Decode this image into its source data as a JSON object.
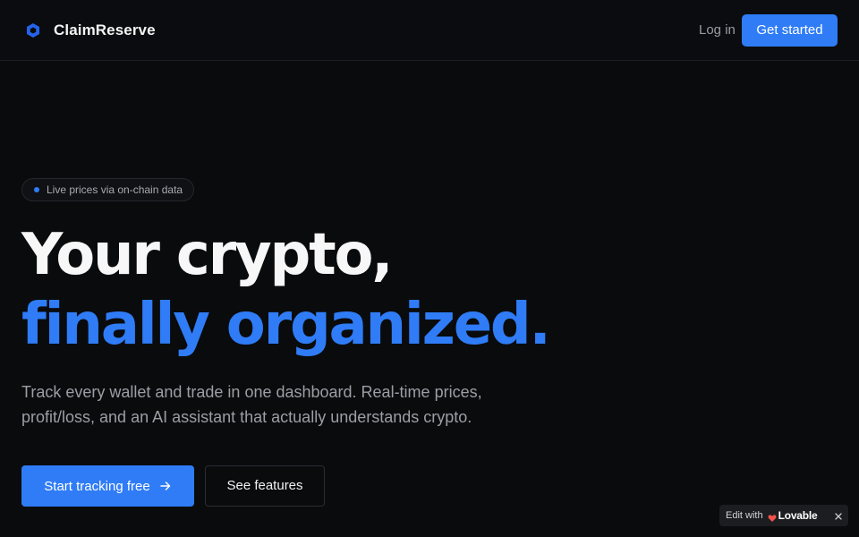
{
  "header": {
    "brand_name": "ClaimReserve",
    "login_label": "Log in",
    "get_started_label": "Get started"
  },
  "hero": {
    "badge_text": "Live prices via on-chain data",
    "headline_line1": "Your crypto,",
    "headline_line2": "finally organized.",
    "subtext_line1": "Track every wallet and trade in one dashboard. Real-time prices,",
    "subtext_line2": "profit/loss, and an AI assistant that actually understands crypto.",
    "primary_cta_label": "Start tracking free",
    "secondary_cta_label": "See features"
  },
  "lovable_badge": {
    "edit_label": "Edit with",
    "brand_label": "Lovable"
  },
  "icons": {
    "brand": "hexagon-logo-icon",
    "arrow": "arrow-right-icon",
    "heart": "heart-icon",
    "close": "close-icon"
  },
  "colors": {
    "accent": "#2f7cf6",
    "background": "#0a0b0d",
    "muted_text": "#9c9ea5"
  }
}
